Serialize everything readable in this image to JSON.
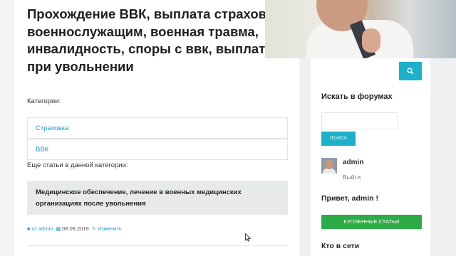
{
  "article": {
    "title": "Прохождение ВВК, выплата страховки военнослужащим, военная травма, инвалидность, споры с ввк, выплаты при увольнении",
    "categories_label": "Категории:",
    "categories": [
      "Страховка",
      "ВВК"
    ],
    "more_label": "Еще статьи в данной категории:",
    "related_title": "Медицинское обеспечение, лечение в военных медицинских организациях после увольнения",
    "meta": {
      "author": "от admin",
      "date": "08.09.2019",
      "edit": "Изменить"
    }
  },
  "sidebar": {
    "search_icon": "search-icon",
    "forum_search_title": "Искать в форумах",
    "forum_search_button": "ПОИСК",
    "user": {
      "name": "admin",
      "logout": "Выйти"
    },
    "greeting": "Привет, admin !",
    "bought_button": "КУПЛЕННЫЕ СТАТЬИ",
    "online_title": "Кто в сети"
  },
  "colors": {
    "accent": "#1db1c9",
    "link": "#1a9cc4",
    "green": "#2dab46"
  }
}
